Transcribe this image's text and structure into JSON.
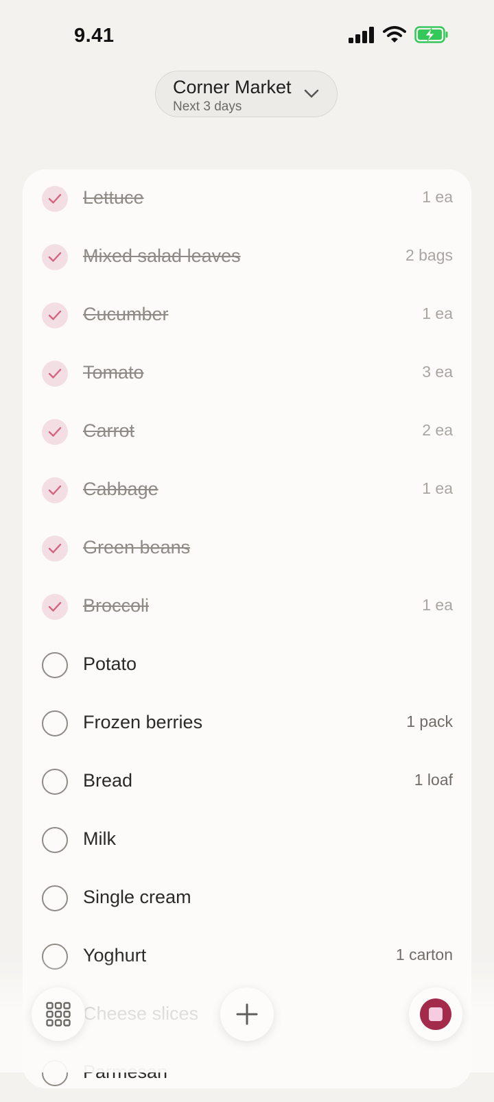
{
  "status_bar": {
    "time": "9.41"
  },
  "header": {
    "store_name": "Corner Market",
    "subtitle": "Next 3 days"
  },
  "items": [
    {
      "name": "Lettuce",
      "qty": "1 ea",
      "checked": true
    },
    {
      "name": "Mixed salad leaves",
      "qty": "2 bags",
      "checked": true
    },
    {
      "name": "Cucumber",
      "qty": "1 ea",
      "checked": true
    },
    {
      "name": "Tomato",
      "qty": "3 ea",
      "checked": true
    },
    {
      "name": "Carrot",
      "qty": "2 ea",
      "checked": true
    },
    {
      "name": "Cabbage",
      "qty": "1 ea",
      "checked": true
    },
    {
      "name": "Green beans",
      "qty": "",
      "checked": true
    },
    {
      "name": "Broccoli",
      "qty": "1 ea",
      "checked": true
    },
    {
      "name": "Potato",
      "qty": "",
      "checked": false
    },
    {
      "name": "Frozen berries",
      "qty": "1 pack",
      "checked": false
    },
    {
      "name": "Bread",
      "qty": "1 loaf",
      "checked": false
    },
    {
      "name": "Milk",
      "qty": "",
      "checked": false
    },
    {
      "name": "Single cream",
      "qty": "",
      "checked": false
    },
    {
      "name": "Yoghurt",
      "qty": "1 carton",
      "checked": false
    },
    {
      "name": "Cheese slices",
      "qty": "",
      "checked": false
    },
    {
      "name": "Parmesan",
      "qty": "",
      "checked": false
    }
  ],
  "colors": {
    "accent": "#a42a4c",
    "check_fill": "#f3dfe3",
    "check_mark": "#d4637f",
    "battery": "#34c759"
  },
  "icons": {
    "grid": "grid-icon",
    "add": "plus-icon",
    "stop": "stop-icon"
  }
}
